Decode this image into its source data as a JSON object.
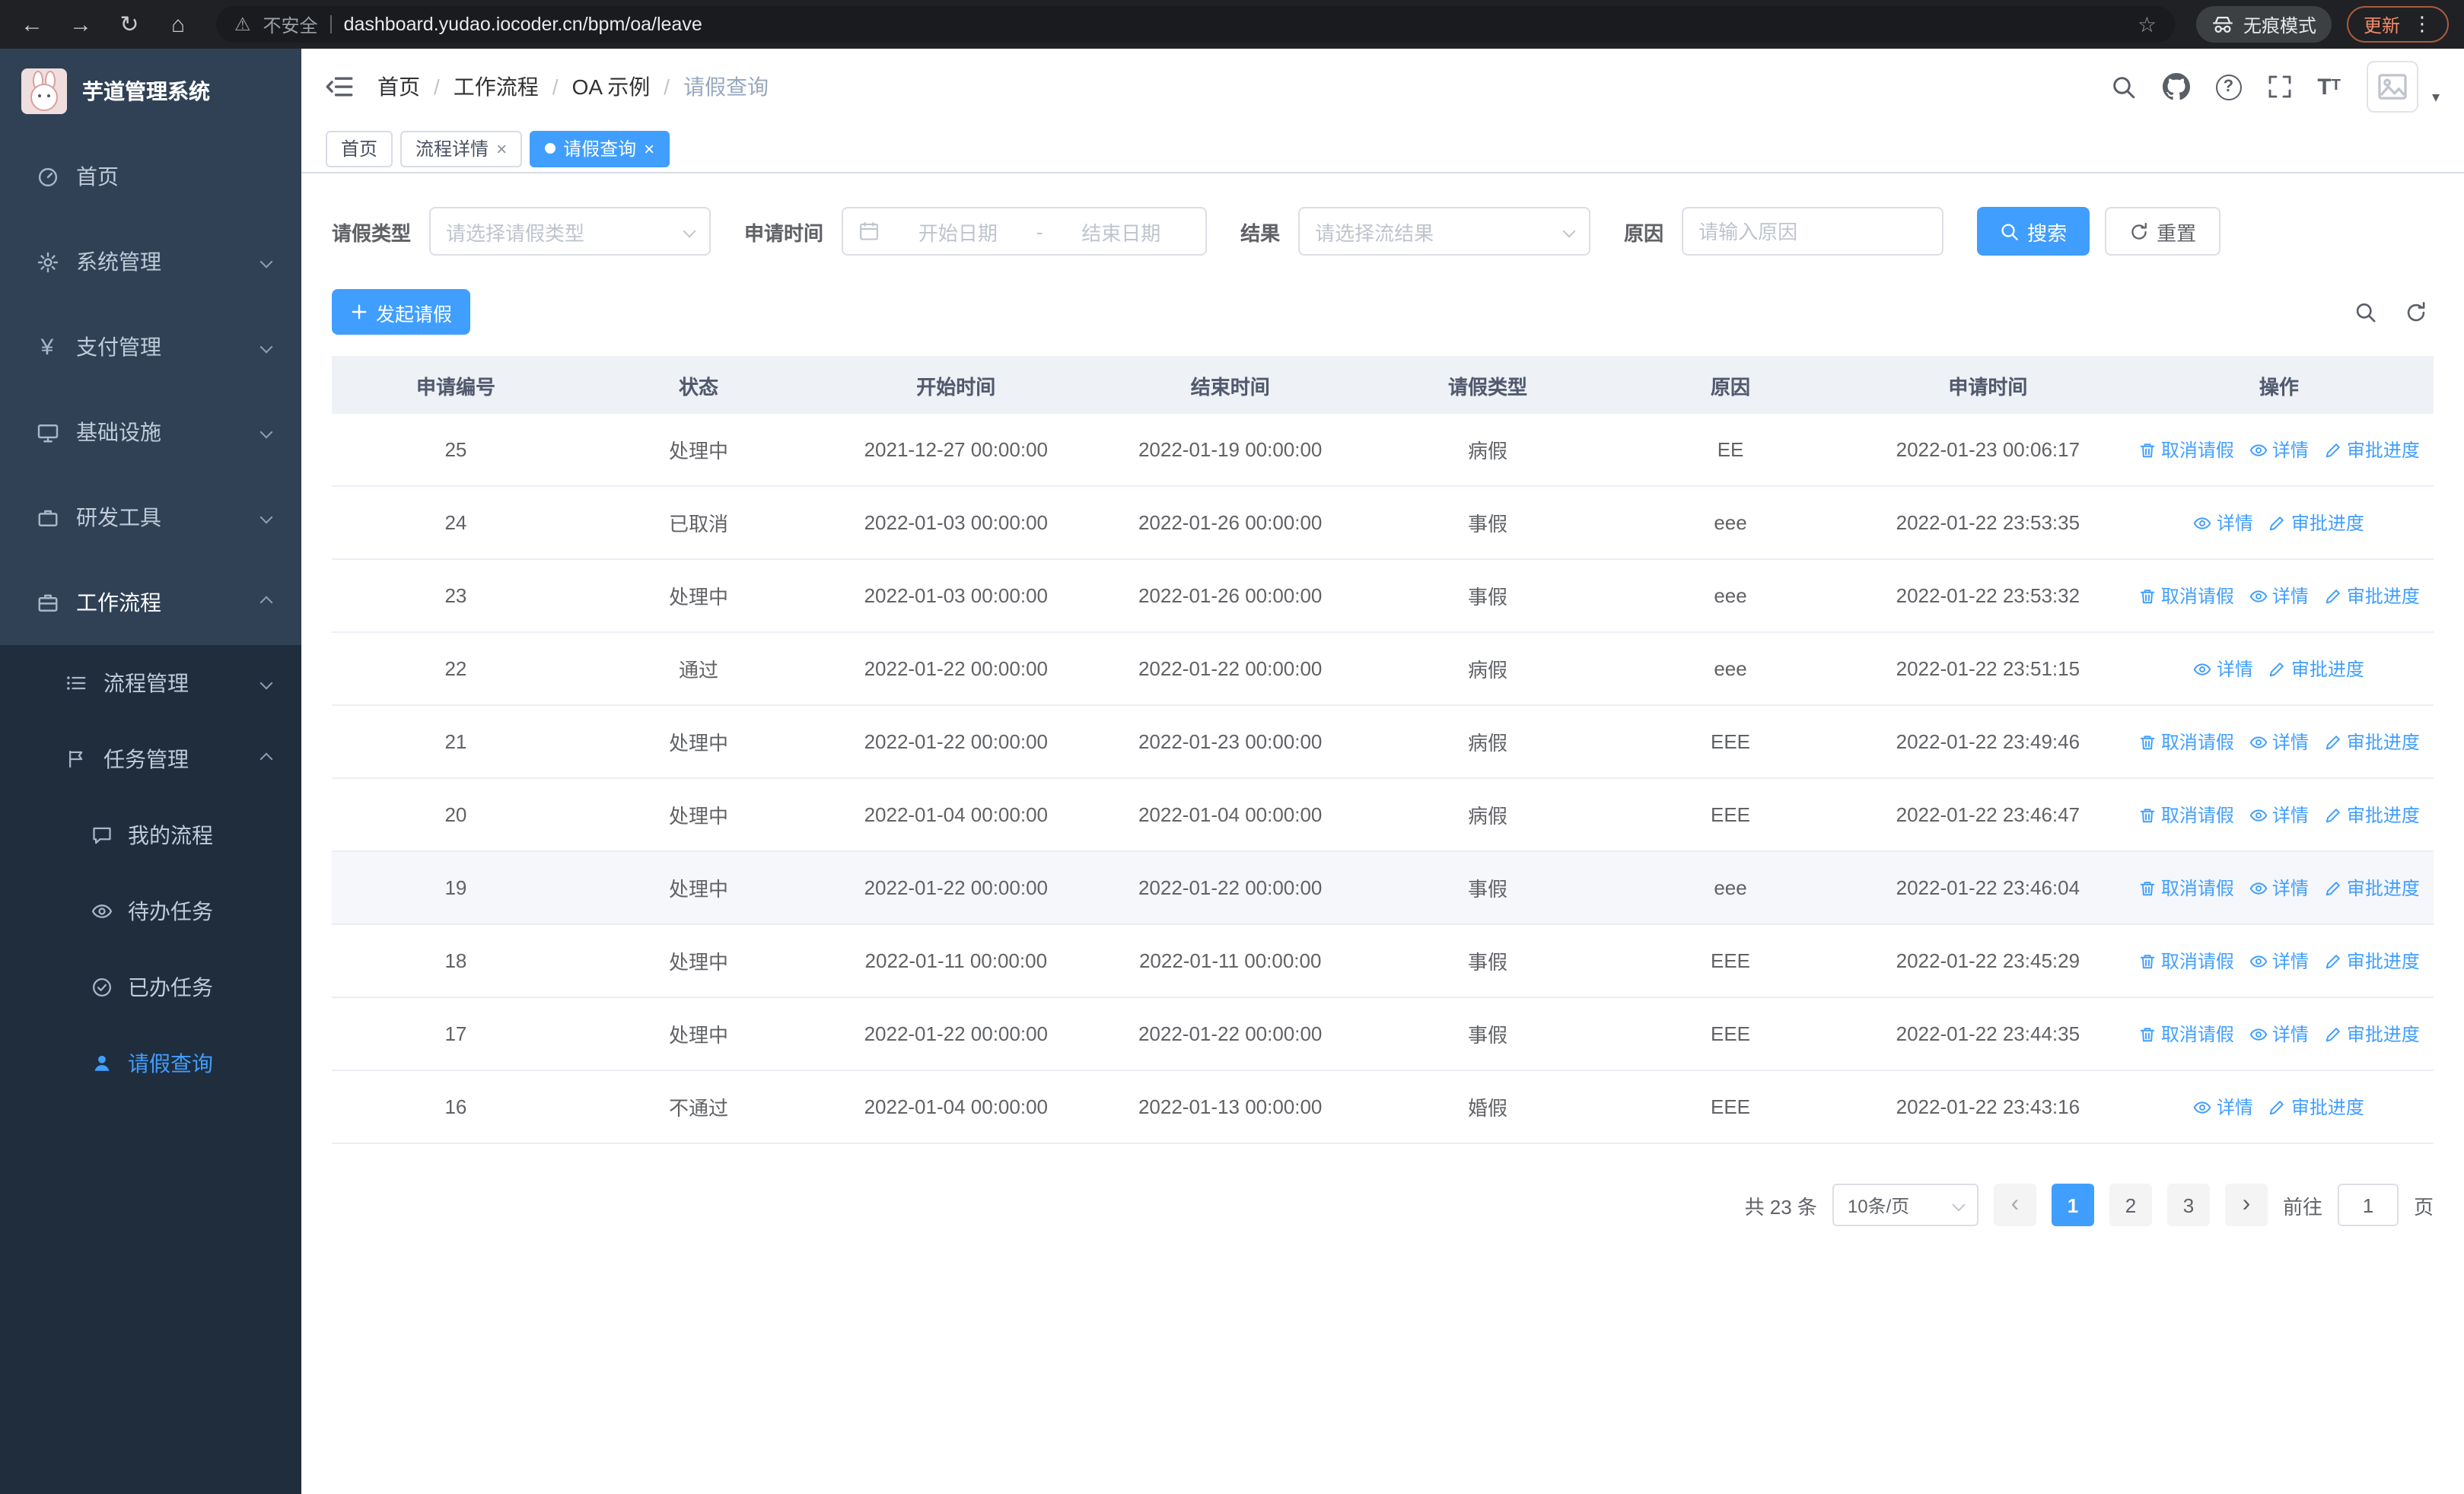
{
  "browser": {
    "security_label": "不安全",
    "url": "dashboard.yudao.iocoder.cn/bpm/oa/leave",
    "incognito_label": "无痕模式",
    "update_label": "更新"
  },
  "icons": {
    "back": "←",
    "forward": "→",
    "reload": "↻",
    "home": "⌂",
    "warning": "⚠",
    "star": "☆",
    "menu_dots": "⋮",
    "close": "×",
    "caret_down": "▾",
    "prev": "‹",
    "next": "›",
    "yen": "¥",
    "question": "?",
    "tsize_big": "T",
    "tsize_small": "T"
  },
  "sidebar": {
    "logo_title": "芋道管理系统",
    "items": [
      {
        "label": "首页"
      },
      {
        "label": "系统管理"
      },
      {
        "label": "支付管理"
      },
      {
        "label": "基础设施"
      },
      {
        "label": "研发工具"
      },
      {
        "label": "工作流程"
      },
      {
        "label": "流程管理"
      },
      {
        "label": "任务管理"
      },
      {
        "label": "我的流程"
      },
      {
        "label": "待办任务"
      },
      {
        "label": "已办任务"
      },
      {
        "label": "请假查询"
      }
    ]
  },
  "header": {
    "breadcrumb": [
      "首页",
      "工作流程",
      "OA 示例",
      "请假查询"
    ],
    "breadcrumb_separator": "/"
  },
  "tabs": [
    {
      "label": "首页"
    },
    {
      "label": "流程详情"
    },
    {
      "label": "请假查询"
    }
  ],
  "filters": {
    "leave_type_label": "请假类型",
    "leave_type_placeholder": "请选择请假类型",
    "apply_time_label": "申请时间",
    "start_date_placeholder": "开始日期",
    "date_separator": "-",
    "end_date_placeholder": "结束日期",
    "result_label": "结果",
    "result_placeholder": "请选择流结果",
    "reason_label": "原因",
    "reason_placeholder": "请输入原因",
    "search_label": "搜索",
    "reset_label": "重置"
  },
  "toolbar": {
    "create_label": "发起请假"
  },
  "table": {
    "columns": [
      "申请编号",
      "状态",
      "开始时间",
      "结束时间",
      "请假类型",
      "原因",
      "申请时间",
      "操作"
    ],
    "action_labels": {
      "cancel": "取消请假",
      "detail": "详情",
      "progress": "审批进度"
    },
    "rows": [
      {
        "id": "25",
        "status": "处理中",
        "start": "2021-12-27 00:00:00",
        "end": "2022-01-19 00:00:00",
        "type": "病假",
        "reason": "EE",
        "apply_time": "2022-01-23 00:06:17",
        "actions": [
          "cancel",
          "detail",
          "progress"
        ]
      },
      {
        "id": "24",
        "status": "已取消",
        "start": "2022-01-03 00:00:00",
        "end": "2022-01-26 00:00:00",
        "type": "事假",
        "reason": "eee",
        "apply_time": "2022-01-22 23:53:35",
        "actions": [
          "detail",
          "progress"
        ]
      },
      {
        "id": "23",
        "status": "处理中",
        "start": "2022-01-03 00:00:00",
        "end": "2022-01-26 00:00:00",
        "type": "事假",
        "reason": "eee",
        "apply_time": "2022-01-22 23:53:32",
        "actions": [
          "cancel",
          "detail",
          "progress"
        ]
      },
      {
        "id": "22",
        "status": "通过",
        "start": "2022-01-22 00:00:00",
        "end": "2022-01-22 00:00:00",
        "type": "病假",
        "reason": "eee",
        "apply_time": "2022-01-22 23:51:15",
        "actions": [
          "detail",
          "progress"
        ]
      },
      {
        "id": "21",
        "status": "处理中",
        "start": "2022-01-22 00:00:00",
        "end": "2022-01-23 00:00:00",
        "type": "病假",
        "reason": "EEE",
        "apply_time": "2022-01-22 23:49:46",
        "actions": [
          "cancel",
          "detail",
          "progress"
        ]
      },
      {
        "id": "20",
        "status": "处理中",
        "start": "2022-01-04 00:00:00",
        "end": "2022-01-04 00:00:00",
        "type": "病假",
        "reason": "EEE",
        "apply_time": "2022-01-22 23:46:47",
        "actions": [
          "cancel",
          "detail",
          "progress"
        ]
      },
      {
        "id": "19",
        "status": "处理中",
        "start": "2022-01-22 00:00:00",
        "end": "2022-01-22 00:00:00",
        "type": "事假",
        "reason": "eee",
        "apply_time": "2022-01-22 23:46:04",
        "actions": [
          "cancel",
          "detail",
          "progress"
        ],
        "highlight": true
      },
      {
        "id": "18",
        "status": "处理中",
        "start": "2022-01-11 00:00:00",
        "end": "2022-01-11 00:00:00",
        "type": "事假",
        "reason": "EEE",
        "apply_time": "2022-01-22 23:45:29",
        "actions": [
          "cancel",
          "detail",
          "progress"
        ]
      },
      {
        "id": "17",
        "status": "处理中",
        "start": "2022-01-22 00:00:00",
        "end": "2022-01-22 00:00:00",
        "type": "事假",
        "reason": "EEE",
        "apply_time": "2022-01-22 23:44:35",
        "actions": [
          "cancel",
          "detail",
          "progress"
        ]
      },
      {
        "id": "16",
        "status": "不通过",
        "start": "2022-01-04 00:00:00",
        "end": "2022-01-13 00:00:00",
        "type": "婚假",
        "reason": "EEE",
        "apply_time": "2022-01-22 23:43:16",
        "actions": [
          "detail",
          "progress"
        ]
      }
    ]
  },
  "pagination": {
    "total_label": "共 23 条",
    "page_size": "10条/页",
    "pages": [
      "1",
      "2",
      "3"
    ],
    "goto_label": "前往",
    "goto_value": "1",
    "page_unit": "页"
  }
}
